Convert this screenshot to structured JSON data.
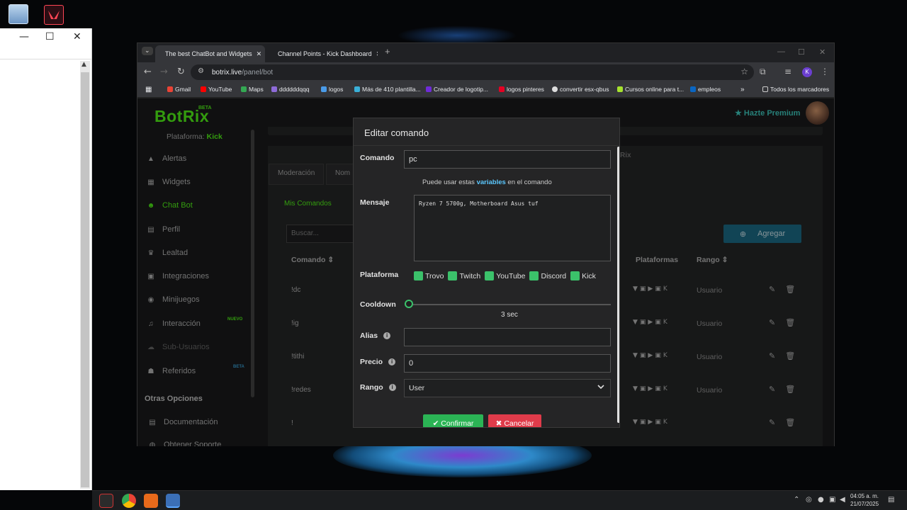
{
  "desktop": {
    "recycle_bin_icon": "recycle-bin-icon",
    "app_shortcut_icon": "valorant-icon"
  },
  "side_window": {
    "minimize": "—",
    "maximize": "☐",
    "close": "✕",
    "scroll_up": "▲"
  },
  "browser": {
    "tabs": [
      {
        "label": "The best ChatBot and Widgets",
        "close": "✕",
        "color": "#ffffff"
      },
      {
        "label": "Channel Points - Kick Dashboard",
        "close": "✕",
        "color": "#53fc18"
      }
    ],
    "new_tab": "+",
    "controls": {
      "minimize": "—",
      "maximize": "☐",
      "close": "✕"
    },
    "url_host": "botrix.live",
    "url_path": "/panel/bot",
    "profile_initial": "K",
    "bookmarks": [
      {
        "label": "Gmail",
        "color": "#ea4335"
      },
      {
        "label": "YouTube",
        "color": "#ff0000"
      },
      {
        "label": "Maps",
        "color": "#34a853"
      },
      {
        "label": "ddddddqqq",
        "color": "#8e6bd8"
      },
      {
        "label": "logos",
        "color": "#4a9be8"
      },
      {
        "label": "Más de 410 plantilla...",
        "color": "#3ab0d8"
      },
      {
        "label": "Creador de logotip...",
        "color": "#6f2bd8"
      },
      {
        "label": "logos pinteres",
        "color": "#e60023"
      },
      {
        "label": "convertir esx-qbus",
        "color": "#dddddd"
      },
      {
        "label": "Cursos online para t...",
        "color": "#a6e22e"
      },
      {
        "label": "empleos",
        "color": "#0a66c2"
      }
    ],
    "bookmarks_more": "»",
    "all_bookmarks": "Todos los marcadores"
  },
  "app": {
    "logo": "BotRix",
    "logo_beta": "BETA",
    "platform_label": "Plataforma:",
    "platform_value": "Kick",
    "nav": [
      {
        "label": "Alertas",
        "icon": "▲"
      },
      {
        "label": "Widgets",
        "icon": "▦"
      },
      {
        "label": "Chat Bot",
        "icon": "☻"
      },
      {
        "label": "Perfil",
        "icon": "▤"
      },
      {
        "label": "Lealtad",
        "icon": "♛"
      },
      {
        "label": "Integraciones",
        "icon": "▣"
      },
      {
        "label": "Minijuegos",
        "icon": "◉"
      },
      {
        "label": "Interacción",
        "icon": "♫"
      },
      {
        "label": "Sub-Usuarios",
        "icon": "☁"
      },
      {
        "label": "Referidos",
        "icon": "☗"
      }
    ],
    "nuevo_badge": "NUEVO",
    "beta_badge": "BETA",
    "otras_opciones": "Otras Opciones",
    "documentacion": "Documentación",
    "obtener_soporte": "Obtener Soporte",
    "premium": "★ Hazte Premium",
    "tabs": [
      "Moderación",
      "Nom"
    ],
    "rix_fragment": "Rix",
    "mis_comandos": "Mis Comandos",
    "search_placeholder": "Buscar...",
    "agregar": "Agregar",
    "col_comando": "Comando ⇕",
    "col_plataformas": "Plataformas",
    "col_rango": "Rango ⇕",
    "commands": [
      {
        "name": "!dc",
        "rango": "Usuario"
      },
      {
        "name": "!ig",
        "rango": "Usuario"
      },
      {
        "name": "!tithi",
        "rango": "Usuario"
      },
      {
        "name": "!redes",
        "rango": "Usuario"
      },
      {
        "name": "!",
        "rango": ""
      }
    ],
    "row_icons": "▼▣▶▣K",
    "row_actions": "✎🗑"
  },
  "modal": {
    "title": "Editar comando",
    "comando_label": "Comando",
    "comando_value": "pc",
    "hint_pre": "Puede usar estas ",
    "hint_link": "variables",
    "hint_post": " en el comando",
    "mensaje_label": "Mensaje",
    "mensaje_value": "Ryzen 7 5700g, Motherboard Asus tuf",
    "plataforma_label": "Plataforma",
    "platforms": [
      "Trovo",
      "Twitch",
      "YouTube",
      "Discord",
      "Kick"
    ],
    "cooldown_label": "Cooldown",
    "cooldown_value": "3 sec",
    "alias_label": "Alias",
    "alias_value": "",
    "precio_label": "Precio",
    "precio_value": "0",
    "rango_label": "Rango",
    "rango_value": "User",
    "confirm": "✔ Confirmar",
    "cancel": "✖ Cancelar"
  },
  "taskbar": {
    "time": "04:05 a. m.",
    "date": "21/07/2025"
  }
}
